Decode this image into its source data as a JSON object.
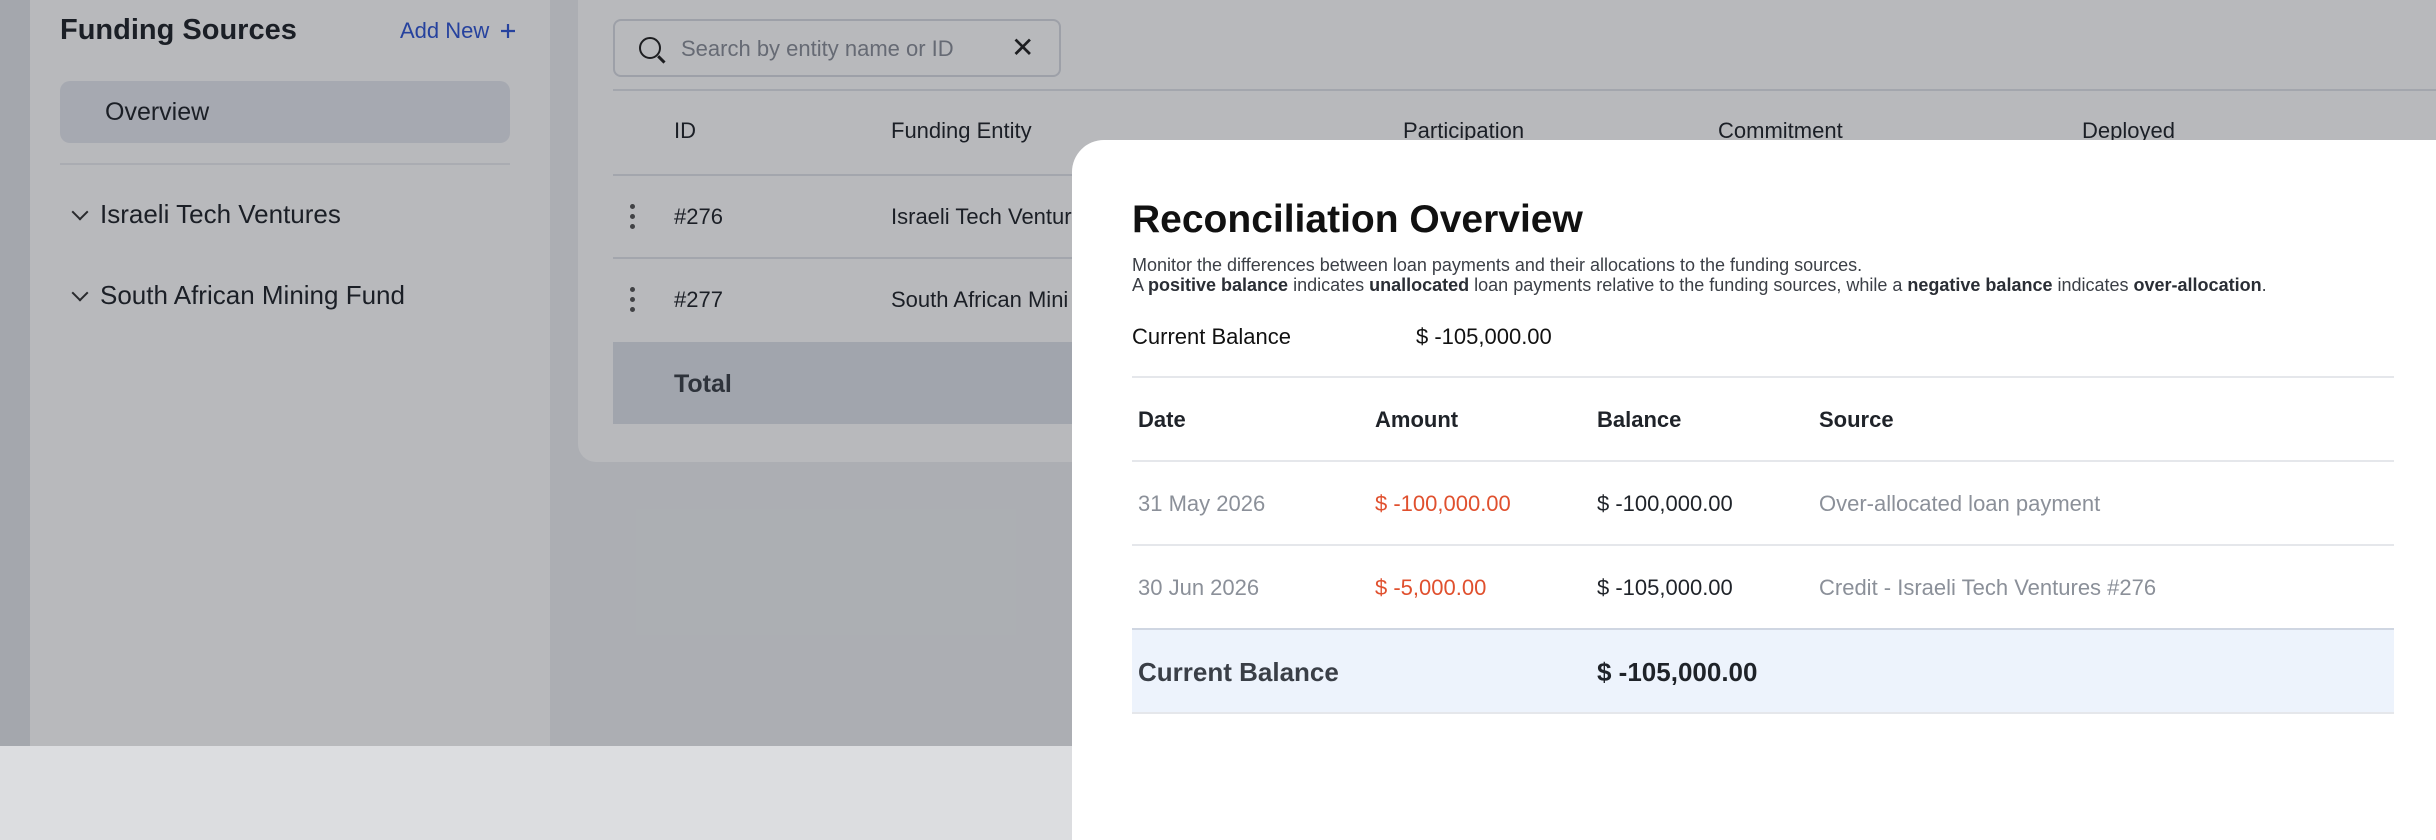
{
  "sidebar": {
    "title": "Funding Sources",
    "add_new_label": "Add New",
    "overview_label": "Overview",
    "items": [
      {
        "label": "Israeli Tech Ventures"
      },
      {
        "label": "South African Mining Fund"
      }
    ]
  },
  "search": {
    "placeholder": "Search by entity name or ID"
  },
  "table": {
    "headers": [
      "ID",
      "Funding Entity",
      "Participation",
      "Commitment",
      "Deployed"
    ],
    "rows": [
      {
        "id": "#276",
        "entity": "Israeli Tech Ventur"
      },
      {
        "id": "#277",
        "entity": "South African Mini"
      }
    ],
    "total_label": "Total"
  },
  "modal": {
    "title": "Reconciliation Overview",
    "desc_line1": "Monitor the differences between loan payments and their allocations to the funding sources.",
    "desc_line2": {
      "a": "A ",
      "positive_balance": "positive balance",
      "indicates1": " indicates ",
      "unallocated": "unallocated",
      "middle": " loan payments relative to the funding sources, while a ",
      "negative_balance": "negative balance",
      "indicates2": " indicates ",
      "over_allocation": "over-allocation",
      "end": "."
    },
    "current_balance_label": "Current Balance",
    "current_balance_value": "$ -105,000.00",
    "table": {
      "headers": [
        "Date",
        "Amount",
        "Balance",
        "Source"
      ],
      "rows": [
        {
          "date": "31 May 2026",
          "amount": "$ -100,000.00",
          "balance": "$ -100,000.00",
          "source": "Over-allocated loan payment"
        },
        {
          "date": "30 Jun 2026",
          "amount": "$ -5,000.00",
          "balance": "$ -105,000.00",
          "source": "Credit - Israeli Tech Ventures #276"
        }
      ],
      "total_label": "Current Balance",
      "total_value": "$ -105,000.00"
    }
  },
  "colors": {
    "accent": "#2f55d4",
    "negative": "#e0502e",
    "total_row_bg": "#edf3fc"
  }
}
